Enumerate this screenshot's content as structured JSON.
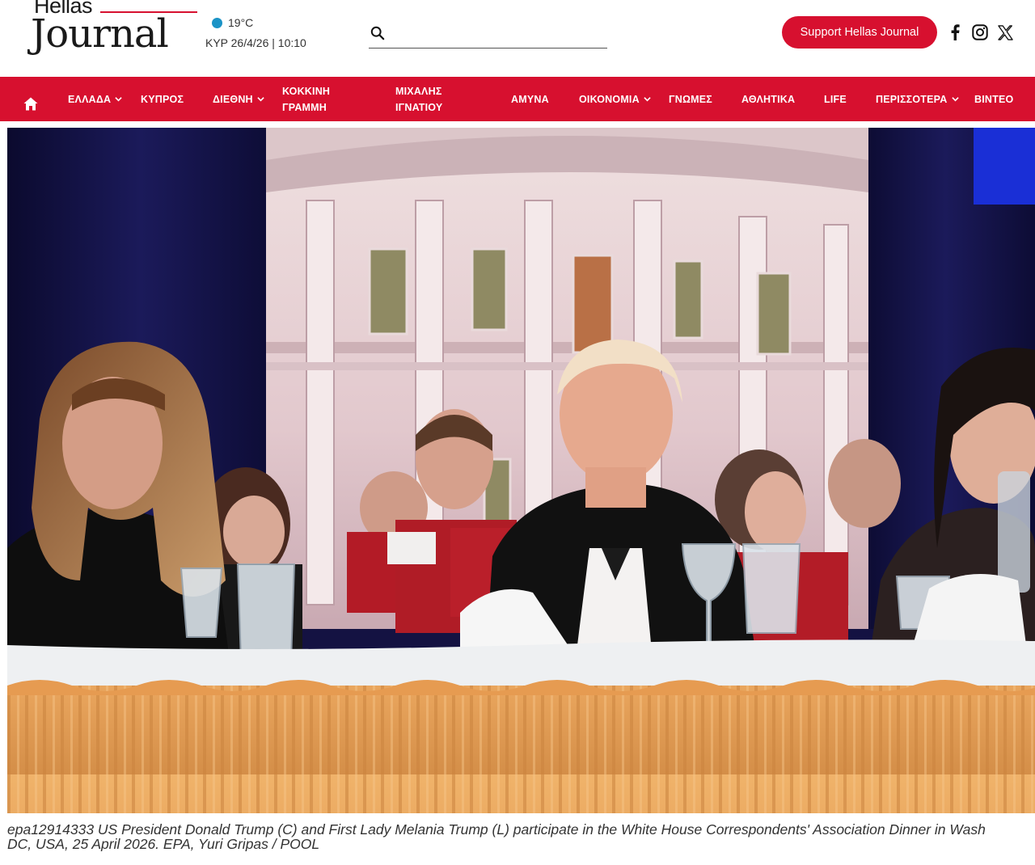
{
  "header": {
    "logo_top": "Hellas",
    "logo_main": "Journal",
    "weather_temp": "19°C",
    "date_time": "ΚΥΡ 26/4/26 | 10:10",
    "search_placeholder": "",
    "support_label": "Support Hellas Journal",
    "social": [
      "facebook-icon",
      "instagram-icon",
      "x-icon"
    ]
  },
  "nav": {
    "items": [
      {
        "label": "ΕΛΛΑΔΑ",
        "dropdown": true
      },
      {
        "label": "ΚΥΠΡΟΣ",
        "dropdown": false
      },
      {
        "label": "ΔΙΕΘΝΗ",
        "dropdown": true
      },
      {
        "label": "ΚΟΚΚΙΝΗ ΓΡΑΜΜΗ",
        "dropdown": false
      },
      {
        "label": "ΜΙΧΑΛΗΣ ΙΓΝΑΤΙΟΥ",
        "dropdown": false
      },
      {
        "label": "ΑΜΥΝΑ",
        "dropdown": false
      },
      {
        "label": "ΟΙΚΟΝΟΜΙΑ",
        "dropdown": true
      },
      {
        "label": "ΓΝΩΜΕΣ",
        "dropdown": false
      },
      {
        "label": "ΑΘΛΗΤΙΚΑ",
        "dropdown": false
      },
      {
        "label": "LIFE",
        "dropdown": false
      },
      {
        "label": "ΠΕΡΙΣΣΟΤΕΡΑ",
        "dropdown": true
      },
      {
        "label": "ΒΙΝΤΕΟ",
        "dropdown": false
      }
    ]
  },
  "article": {
    "caption_line1": "epa12914333 US President Donald Trump (C) and First Lady Melania Trump (L) participate in the White House Correspondents' Association Dinner in Wash",
    "caption_line2": "DC, USA, 25 April 2026. EPA, Yuri Gripas / POOL"
  },
  "colors": {
    "brand_red": "#d7102f",
    "weather_dot": "#1b93c6"
  }
}
